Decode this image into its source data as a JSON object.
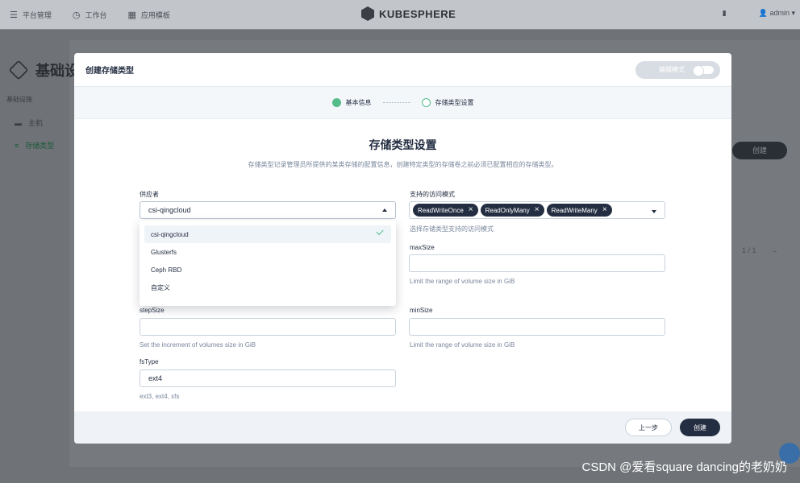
{
  "topbar": {
    "nav": [
      {
        "icon": "menu-icon",
        "glyph": "☰",
        "label": "平台管理"
      },
      {
        "icon": "workbench-icon",
        "glyph": "◷",
        "label": "工作台"
      },
      {
        "icon": "app-templates-icon",
        "glyph": "▦",
        "label": "应用模板"
      }
    ],
    "logo_text": "KUBESPHERE",
    "user": "admin"
  },
  "background": {
    "page_title": "基础设",
    "side_label": "基础设施",
    "side_items": [
      "主机",
      "存储类型"
    ],
    "create_label": "创建",
    "pager": "1 / 1"
  },
  "modal": {
    "title": "创建存储类型",
    "edit_mode_label": "编辑模式",
    "steps": [
      "基本信息",
      "存储类型设置"
    ],
    "section_title": "存储类型设置",
    "section_desc": "存储类型记录管理员所提供的某类存储的配置信息，创建特定类型的存储卷之前必须已配置相应的存储类型。",
    "provider": {
      "label": "供应者",
      "value": "csi-qingcloud",
      "options": [
        "csi-qingcloud",
        "Glusterfs",
        "Ceph RBD",
        "自定义"
      ]
    },
    "access_modes": {
      "label": "支持的访问模式",
      "tags": [
        "ReadWriteOnce",
        "ReadOnlyMany",
        "ReadWriteMany"
      ],
      "hint": "选择存储类型支持的访问模式"
    },
    "maxSize": {
      "label": "maxSize",
      "value": "",
      "hint": "Limit the range of volume size in GiB"
    },
    "stepSize": {
      "label": "stepSize",
      "value": "",
      "hint": "Set the increment of volumes size in GiB"
    },
    "minSize": {
      "label": "minSize",
      "value": "",
      "hint": "Limit the range of volume size in GiB"
    },
    "fsType": {
      "label": "fsType",
      "value": "ext4",
      "hint": "ext3, ext4, xfs"
    },
    "footer": {
      "prev_label": "上一步",
      "create_label": "创建"
    }
  },
  "watermark": "CSDN @爱看square dancing的老奶奶",
  "colors": {
    "accent": "#55bc8a",
    "dark": "#242e42"
  }
}
